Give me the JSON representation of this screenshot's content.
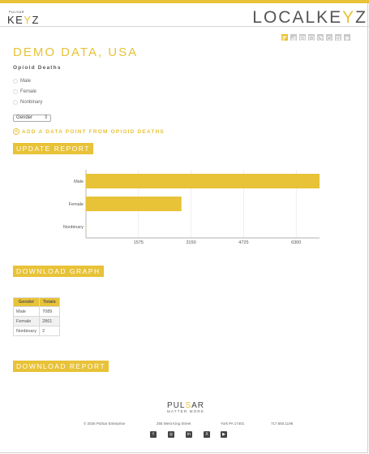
{
  "header": {
    "small_logo_tiny": "PULSAR",
    "small_logo_word_a": "KE",
    "small_logo_word_y": "Y",
    "small_logo_word_b": "Z",
    "big_logo_a": "LOCALKE",
    "big_logo_y": "Y",
    "big_logo_b": "Z"
  },
  "toolbar": {
    "icons": [
      "bar-chart-icon",
      "column-chart-icon",
      "table-icon",
      "list-icon",
      "pie-chart-icon",
      "map-icon",
      "grid-icon",
      "settings-icon"
    ]
  },
  "page": {
    "title": "DEMO DATA, USA",
    "subtitle": "Opioid Deaths"
  },
  "filters": {
    "options": [
      "Male",
      "Female",
      "Nonbinary"
    ],
    "select_value": "Gender",
    "select_caret": "⇕",
    "add_label": "ADD A DATA POINT FROM OPIOID DEATHS"
  },
  "buttons": {
    "update": "UPDATE REPORT",
    "download_graph": "DOWNLOAD GRAPH",
    "download_report": "DOWNLOAD REPORT"
  },
  "chart_data": {
    "type": "bar",
    "orientation": "horizontal",
    "categories": [
      "Male",
      "Female",
      "Nonbinary"
    ],
    "values": [
      7089,
      2861,
      2
    ],
    "xlim": [
      0,
      7000
    ],
    "xticks": [
      "1575",
      "3150",
      "4725",
      "6300"
    ],
    "xtick_values": [
      1575,
      3150,
      4725,
      6300
    ],
    "grid": true,
    "color": "#e8c237"
  },
  "table": {
    "headers": [
      "Gender",
      "Totals"
    ],
    "rows": [
      [
        "Male",
        "7089"
      ],
      [
        "Female",
        "2861"
      ],
      [
        "Nonbinary",
        "2"
      ]
    ]
  },
  "footer": {
    "logo_a": "PUL",
    "logo_s": "S",
    "logo_b": "AR",
    "tagline": "MATTER MORE",
    "copyright": "© 2026 PulSar Enterprise",
    "street": "255 West King Street",
    "city": "York PA 17401",
    "phone": "717.650.1196",
    "social": [
      "f",
      "◎",
      "in",
      "X",
      "▶"
    ]
  },
  "colors": {
    "accent": "#e8c237"
  }
}
